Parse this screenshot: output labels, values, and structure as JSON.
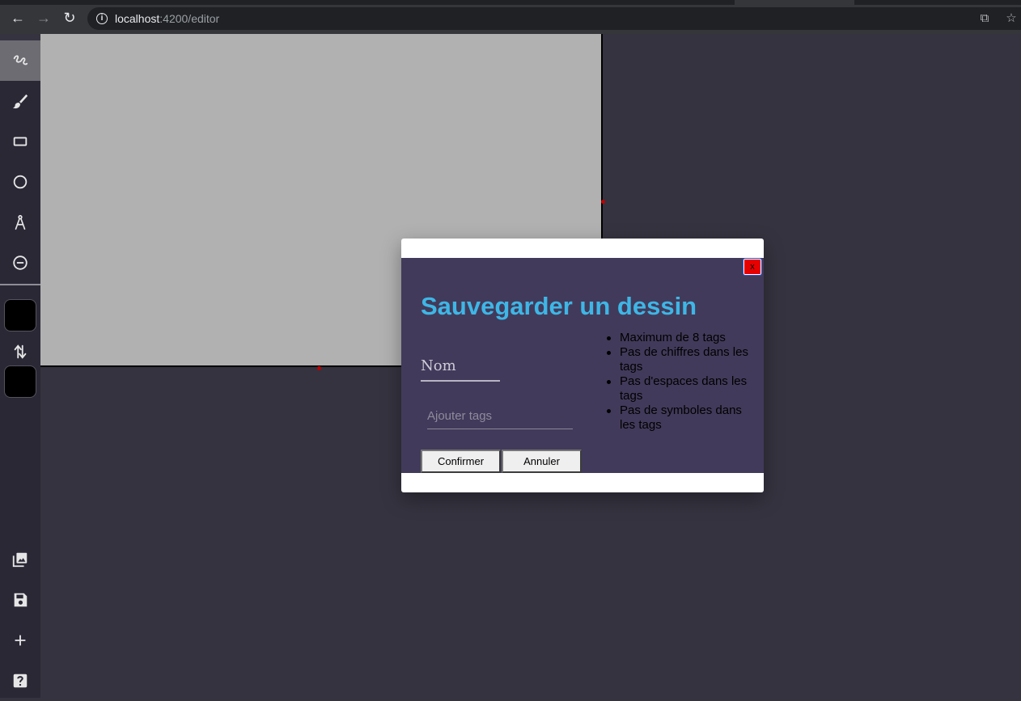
{
  "browser": {
    "url_host": "localhost",
    "url_rest": ":4200/editor",
    "back_glyph": "←",
    "forward_glyph": "→",
    "reload_glyph": "↻",
    "info_glyph": "i",
    "translate_glyph": "⧉",
    "bookmark_glyph": "☆"
  },
  "toolbar": {
    "tools": [
      {
        "name": "pencil-tool",
        "icon": "scribble-icon",
        "active": true
      },
      {
        "name": "brush-tool",
        "icon": "brush-icon",
        "active": false
      },
      {
        "name": "rectangle-tool",
        "icon": "rectangle-icon",
        "active": false
      },
      {
        "name": "ellipse-tool",
        "icon": "circle-icon",
        "active": false
      },
      {
        "name": "line-tool",
        "icon": "compass-icon",
        "active": false
      },
      {
        "name": "eraser-tool",
        "icon": "minus-circle-icon",
        "active": false
      }
    ],
    "primary_color": "#000000",
    "secondary_color": "#000000",
    "bottom_tools": [
      {
        "name": "gallery-button",
        "icon": "image-library-icon"
      },
      {
        "name": "save-button",
        "icon": "floppy-disk-icon"
      },
      {
        "name": "new-drawing-button",
        "icon": "plus-icon"
      },
      {
        "name": "help-button",
        "icon": "help-icon"
      }
    ]
  },
  "canvas": {
    "background": "#b1b1b1"
  },
  "modal": {
    "close_label": "x",
    "title": "Sauvegarder un dessin",
    "name_placeholder": "Nom",
    "tags_placeholder": "Ajouter tags",
    "rules": [
      "Maximum de 8 tags",
      "Pas de chiffres dans les tags",
      "Pas d'espaces dans les tags",
      "Pas de symboles dans les tags"
    ],
    "confirm_label": "Confirmer",
    "cancel_label": "Annuler"
  }
}
